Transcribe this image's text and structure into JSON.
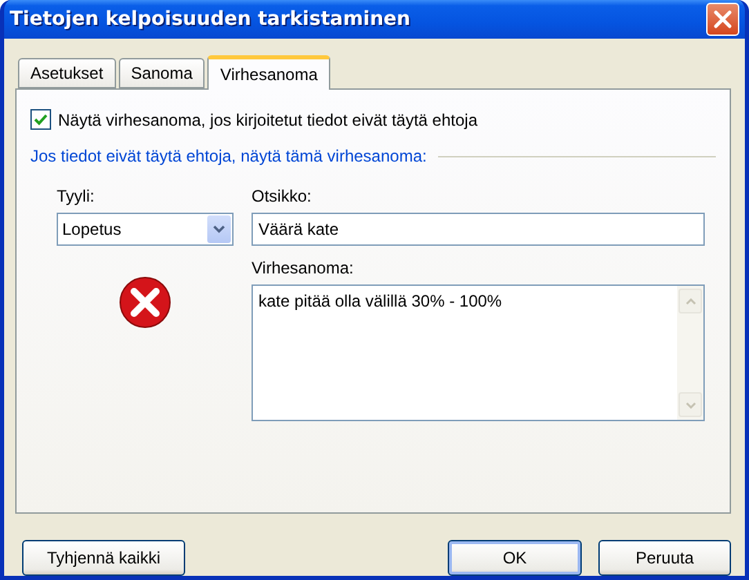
{
  "window": {
    "title": "Tietojen kelpoisuuden tarkistaminen"
  },
  "tabs": [
    {
      "label": "Asetukset",
      "selected": false
    },
    {
      "label": "Sanoma",
      "selected": false
    },
    {
      "label": "Virhesanoma",
      "selected": true
    }
  ],
  "show_error_checkbox": {
    "label": "Näytä virhesanoma, jos kirjoitetut tiedot eivät täytä ehtoja",
    "checked": true
  },
  "group_label": "Jos tiedot eivät täytä ehtoja, näytä tämä virhesanoma:",
  "style": {
    "label": "Tyyli:",
    "value": "Lopetus"
  },
  "title_field": {
    "label": "Otsikko:",
    "value": "Väärä kate"
  },
  "message_field": {
    "label": "Virhesanoma:",
    "value": "kate pitää olla välillä 30% - 100%"
  },
  "buttons": [
    {
      "label": "Tyhjennä kaikki",
      "kind": "left"
    },
    {
      "label": "OK",
      "kind": "default"
    },
    {
      "label": "Peruuta",
      "kind": "normal"
    }
  ]
}
